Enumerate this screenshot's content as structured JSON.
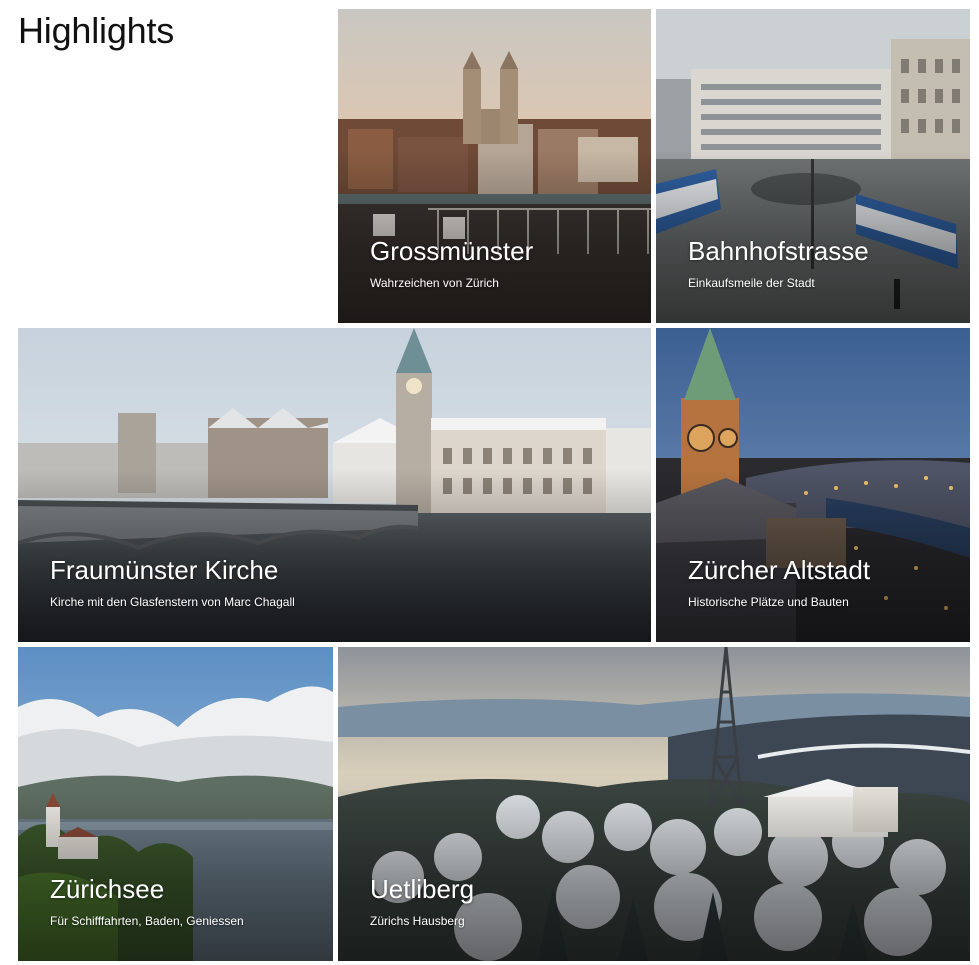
{
  "section": {
    "title": "Highlights"
  },
  "tiles": [
    {
      "title": "Grossmünster",
      "subtitle": "Wahrzeichen von Zürich",
      "image": "church-twin-towers-over-limmat-photo"
    },
    {
      "title": "Bahnhofstrasse",
      "subtitle": "Einkaufsmeile der Stadt",
      "image": "tram-square-with-blue-trams-photo"
    },
    {
      "title": "Fraumünster Kirche",
      "subtitle": "Kirche mit den Glasfenstern von Marc Chagall",
      "image": "winter-bridge-and-church-spire-photo"
    },
    {
      "title": "Zürcher Altstadt",
      "subtitle": "Historische Plätze und Bauten",
      "image": "old-town-night-clock-tower-photo"
    },
    {
      "title": "Zürichsee",
      "subtitle": "Für Schifffahrten, Baden, Geniessen",
      "image": "lake-with-clouds-and-chapel-photo"
    },
    {
      "title": "Uetliberg",
      "subtitle": "Zürichs Hausberg",
      "image": "snowy-forest-with-radio-tower-photo"
    }
  ],
  "colors": {
    "title_text": "#111111",
    "caption_text": "#ffffff",
    "background": "#ffffff"
  }
}
